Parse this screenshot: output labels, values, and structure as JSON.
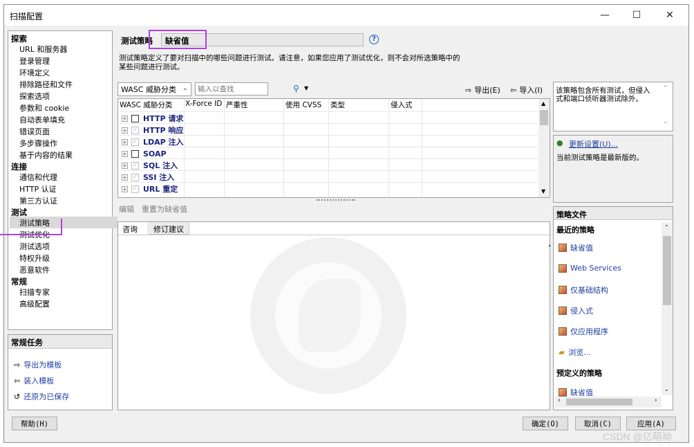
{
  "window": {
    "title": "扫描配置",
    "minimize": "—",
    "maximize": "☐",
    "close": "✕"
  },
  "nav": {
    "sections": [
      {
        "title": "探索",
        "items": [
          "URL 和服务器",
          "登录管理",
          "环境定义",
          "排除路径和文件",
          "探索选项",
          "参数和 cookie",
          "自动表单填充",
          "错误页面",
          "多步骤操作",
          "基于内容的结果"
        ]
      },
      {
        "title": "连接",
        "items": [
          "通信和代理",
          "HTTP 认证",
          "第三方认证"
        ]
      },
      {
        "title": "测试",
        "items": [
          "测试策略",
          "测试优化",
          "测试选项",
          "特权升级",
          "恶意软件"
        ]
      },
      {
        "title": "常规",
        "items": [
          "扫描专家",
          "高级配置"
        ]
      }
    ],
    "selected": "测试策略"
  },
  "tasks": {
    "title": "常规任务",
    "items": [
      {
        "icon": "export-icon",
        "label": "导出为模板"
      },
      {
        "icon": "import-icon",
        "label": "装入模板"
      },
      {
        "icon": "restore-icon",
        "label": "还原为已保存"
      }
    ]
  },
  "policy": {
    "label": "测试策略",
    "value": "缺省值",
    "help": "?",
    "description_line1": "测试策略定义了要对扫描中的哪些问题进行测试。请注意，如果您应用了测试优化，则不会对所选策略中的",
    "description_line2": "某些问题进行测试。"
  },
  "toolbar": {
    "group_by": "WASC 威胁分类",
    "search_placeholder": "输入以查找",
    "export_label": "导出(E)",
    "import_label": "导入(I)"
  },
  "grid": {
    "columns": [
      "WASC 威胁分类",
      "X-Force ID",
      "严重性",
      "使用 CVSS",
      "类型",
      "侵入式"
    ],
    "rows": [
      {
        "label": "HTTP 请求",
        "checked": false,
        "grayed": false
      },
      {
        "label": "HTTP 响应",
        "checked": true,
        "grayed": true
      },
      {
        "label": "LDAP 注入",
        "checked": true,
        "grayed": true
      },
      {
        "label": "SOAP",
        "checked": false,
        "grayed": false
      },
      {
        "label": "SQL 注入",
        "checked": true,
        "grayed": true
      },
      {
        "label": "SSI 注入",
        "checked": true,
        "grayed": true
      },
      {
        "label": "URL 重定",
        "checked": true,
        "grayed": true
      }
    ]
  },
  "edit_links": {
    "edit": "编辑",
    "reset": "重置为缺省值"
  },
  "detail_tabs": [
    "咨询",
    "修订建议"
  ],
  "info_box": {
    "text_line1": "该策略包含所有测试，但侵入",
    "text_line2": "式和端口侦听器测试除外。"
  },
  "update_box": {
    "link": "更新设置(U)...",
    "status": "当前测试策略是最新版的。"
  },
  "policy_files": {
    "title": "策略文件",
    "recent_title": "最近的策略",
    "recent": [
      "缺省值",
      "Web Services",
      "仅基础结构",
      "侵入式",
      "仅应用程序"
    ],
    "browse": "浏览...",
    "predefined_title": "预定义的策略",
    "predefined": [
      "缺省值"
    ]
  },
  "buttons": {
    "help": "帮助(H)",
    "ok": "确定(O)",
    "cancel": "取消(C)",
    "apply": "应用(A)"
  },
  "watermark": "CSDN @亿萌呦",
  "colors": {
    "highlight": "#b040e0",
    "link": "#1f3fa0",
    "tree_label": "#1a237e"
  }
}
